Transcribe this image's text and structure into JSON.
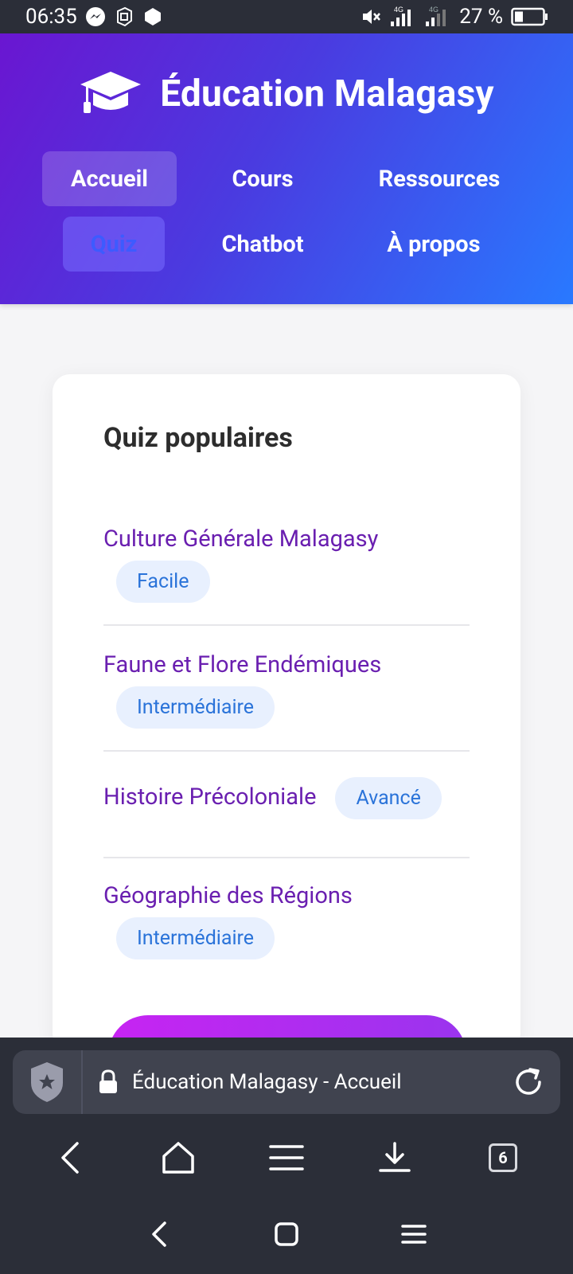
{
  "status_bar": {
    "time": "06:35",
    "battery": "27 %",
    "network": "4G",
    "icons_left": [
      "messenger-icon",
      "app-notification-icon",
      "shield-notification-icon"
    ],
    "icons_right": [
      "mute-icon",
      "signal-icon",
      "signal-icon",
      "battery-icon"
    ]
  },
  "header": {
    "logo_icon": "graduation-cap-icon",
    "title": "Éducation Malagasy",
    "nav": [
      {
        "label": "Accueil"
      },
      {
        "label": "Cours"
      },
      {
        "label": "Ressources"
      },
      {
        "label": "Quiz"
      },
      {
        "label": "Chatbot"
      },
      {
        "label": "À propos"
      }
    ]
  },
  "quiz_section": {
    "title": "Quiz populaires",
    "items": [
      {
        "name": "Culture Générale Malagasy",
        "level": "Facile"
      },
      {
        "name": "Faune et Flore Endémiques",
        "level": "Intermédiaire"
      },
      {
        "name": "Histoire Précoloniale",
        "level": "Avancé"
      },
      {
        "name": "Géographie des Régions",
        "level": "Intermédiaire"
      }
    ]
  },
  "browser": {
    "page_title": "Éducation Malagasy - Accueil",
    "tab_count": "6"
  },
  "colors": {
    "header_gradient": [
      "#6a16d1",
      "#2979ff"
    ],
    "link": "#6a1fb0",
    "badge_bg": "#e8f0fe",
    "badge_text": "#2a73d9",
    "chrome": "#2b2e38"
  }
}
